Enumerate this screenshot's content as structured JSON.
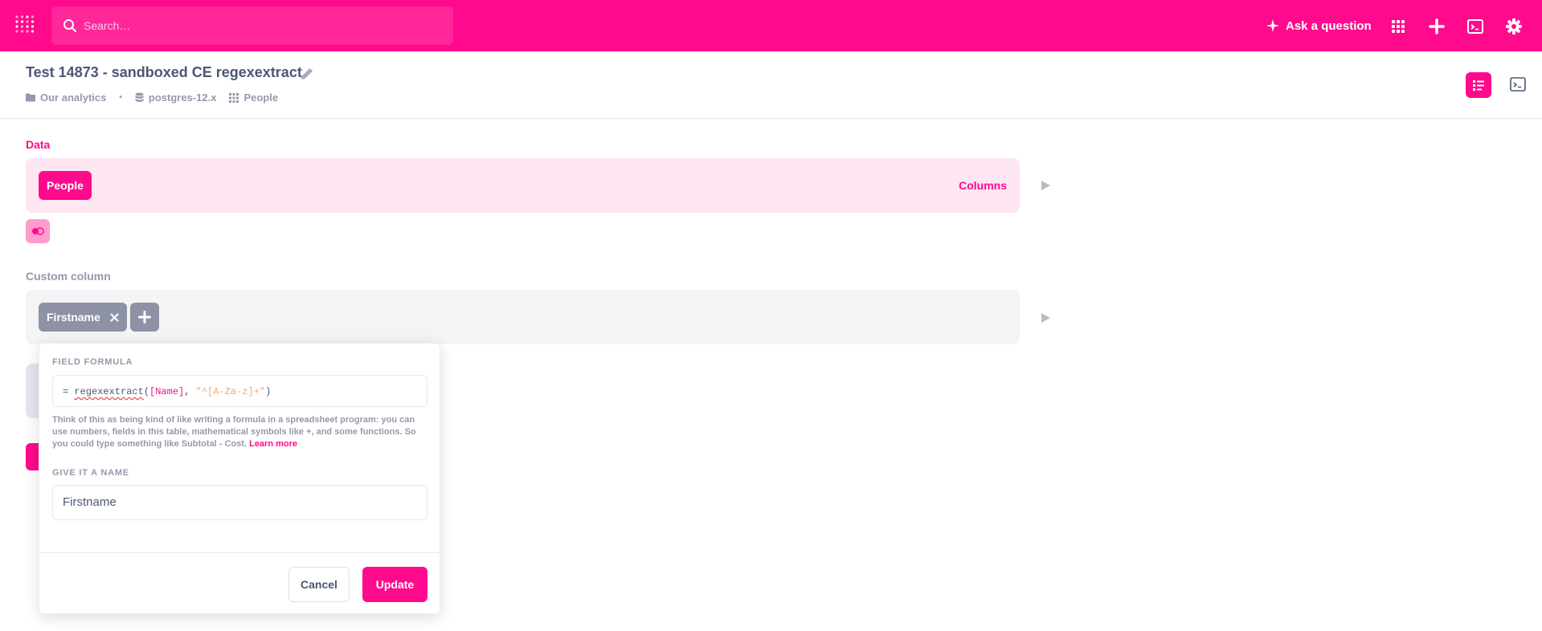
{
  "topnav": {
    "search_placeholder": "Search…",
    "ask_label": "Ask a question",
    "accent": "#ff0a8c"
  },
  "header": {
    "title": "Test 14873 - sandboxed CE regexextract",
    "breadcrumbs": [
      {
        "icon": "folder-icon",
        "label": "Our analytics"
      },
      {
        "icon": "database-icon",
        "label": "postgres-12.x"
      },
      {
        "icon": "table-grid-icon",
        "label": "People"
      }
    ]
  },
  "notebook": {
    "data_step": {
      "label": "Data",
      "table_pill": "People",
      "columns_label": "Columns"
    },
    "custom_step": {
      "label": "Custom column",
      "column_pill": "Firstname"
    }
  },
  "popover": {
    "formula_label": "FIELD FORMULA",
    "formula": {
      "prefix": "= ",
      "fn": "regexextract",
      "open": "(",
      "field": "[Name]",
      "comma": ", ",
      "string": "\"^[A-Za-z]+\"",
      "close": ")"
    },
    "help_text": "Think of this as being kind of like writing a formula in a spreadsheet program: you can use numbers, fields in this table, mathematical symbols like +, and some functions. So you could type something like Subtotal - Cost.",
    "learn_more": "Learn more",
    "name_label": "GIVE IT A NAME",
    "name_value": "Firstname",
    "cancel": "Cancel",
    "update": "Update"
  }
}
